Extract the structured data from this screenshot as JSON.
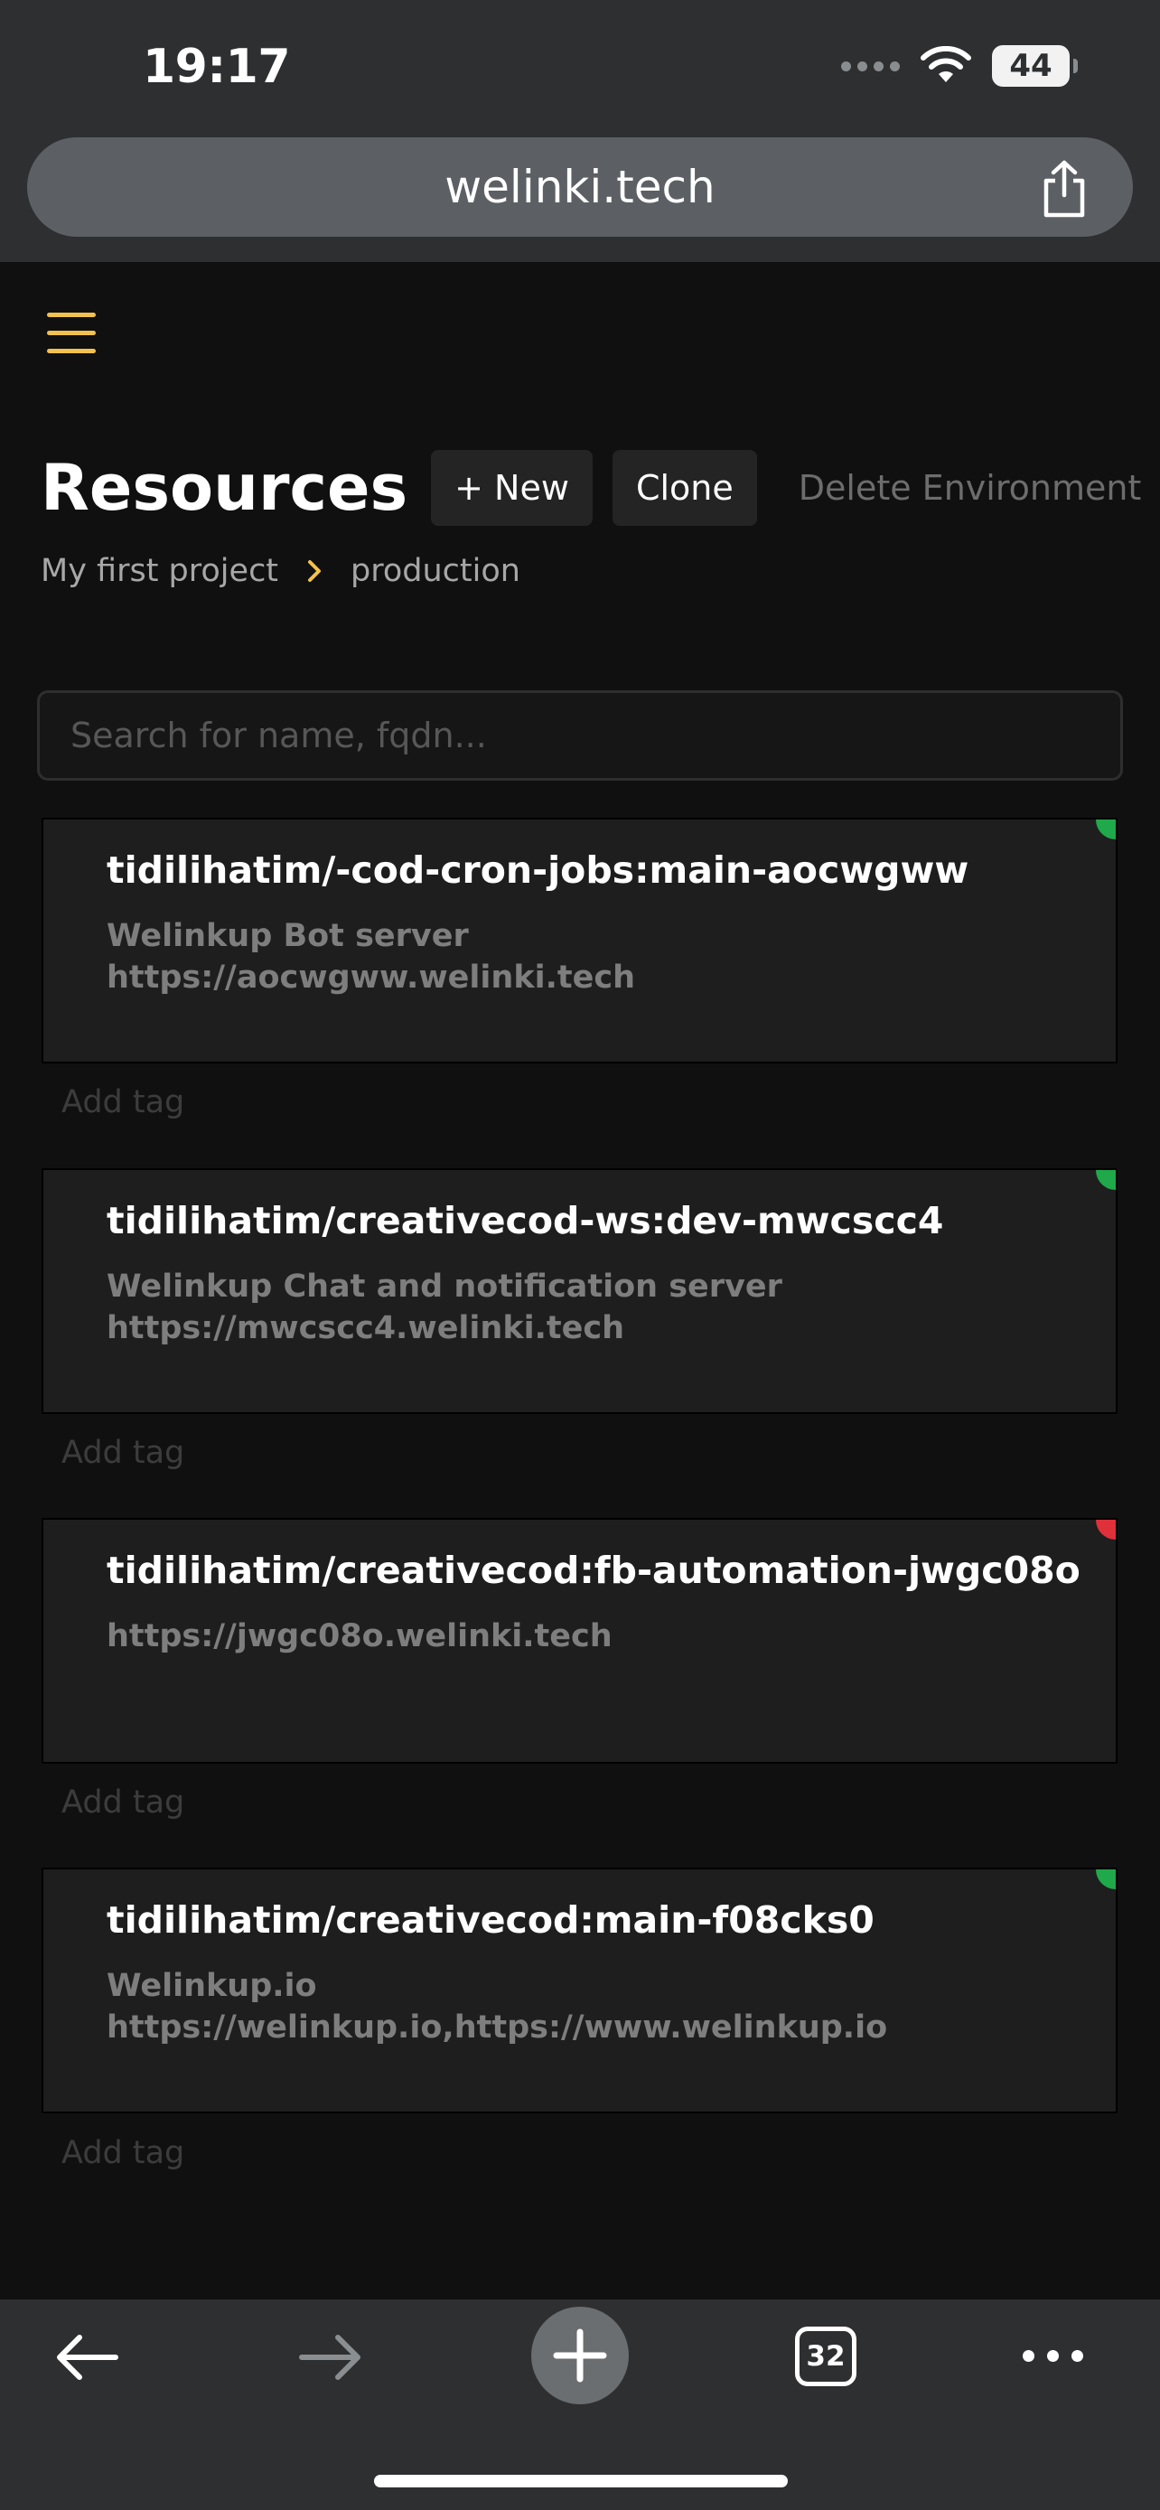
{
  "status_bar": {
    "time": "19:17",
    "battery": "44"
  },
  "browser": {
    "url": "welinki.tech",
    "tab_count": "32"
  },
  "header": {
    "title": "Resources",
    "new_label": "+ New",
    "clone_label": "Clone",
    "delete_label": "Delete Environment"
  },
  "breadcrumb": {
    "project": "My first project",
    "environment": "production"
  },
  "search": {
    "placeholder": "Search for name, fqdn..."
  },
  "resources": [
    {
      "name": "tidilihatim/-cod-cron-jobs:main-aocwgww",
      "description": "Welinkup Bot server",
      "url": "https://aocwgww.welinki.tech",
      "status_color": "#1fa94a",
      "tag_label": "Add tag"
    },
    {
      "name": "tidilihatim/creativecod-ws:dev-mwcscc4",
      "description": "Welinkup Chat and notification server",
      "url": "https://mwcscc4.welinki.tech",
      "status_color": "#1fa94a",
      "tag_label": "Add tag"
    },
    {
      "name": "tidilihatim/creativecod:fb-automation-jwgc08o",
      "description": "",
      "url": "https://jwgc08o.welinki.tech",
      "status_color": "#e0303a",
      "tag_label": "Add tag"
    },
    {
      "name": "tidilihatim/creativecod:main-f08cks0",
      "description": "Welinkup.io",
      "url": "https://welinkup.io,https://www.welinkup.io",
      "status_color": "#1fa94a",
      "tag_label": "Add tag"
    }
  ],
  "colors": {
    "accent": "#f2c14e",
    "running": "#1fa94a",
    "stopped": "#e0303a"
  }
}
